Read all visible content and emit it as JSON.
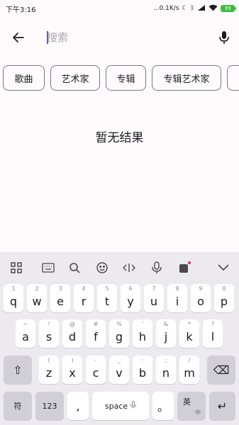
{
  "status": {
    "time": "下午3:16",
    "right_text": "...0.1K/s",
    "battery": "39"
  },
  "search": {
    "placeholder": "搜索"
  },
  "chips": [
    "歌曲",
    "艺术家",
    "专辑",
    "专辑艺术家"
  ],
  "empty_text": "暂无结果",
  "keyboard": {
    "row1": [
      {
        "main": "q",
        "hint": "1"
      },
      {
        "main": "w",
        "hint": "2"
      },
      {
        "main": "e",
        "hint": "3"
      },
      {
        "main": "r",
        "hint": "4"
      },
      {
        "main": "t",
        "hint": "5"
      },
      {
        "main": "y",
        "hint": "6"
      },
      {
        "main": "u",
        "hint": "7"
      },
      {
        "main": "i",
        "hint": "8"
      },
      {
        "main": "o",
        "hint": "9"
      },
      {
        "main": "p",
        "hint": "0"
      }
    ],
    "row2": [
      {
        "main": "a",
        "hint": "~"
      },
      {
        "main": "s",
        "hint": "!"
      },
      {
        "main": "d",
        "hint": "@"
      },
      {
        "main": "f",
        "hint": "#"
      },
      {
        "main": "g",
        "hint": "%"
      },
      {
        "main": "h",
        "hint": "'"
      },
      {
        "main": "j",
        "hint": "&"
      },
      {
        "main": "k",
        "hint": "*"
      },
      {
        "main": "l",
        "hint": "?"
      }
    ],
    "row3": [
      {
        "main": "z",
        "hint": "("
      },
      {
        "main": "x",
        "hint": ")"
      },
      {
        "main": "c",
        "hint": "-"
      },
      {
        "main": "v",
        "hint": "_"
      },
      {
        "main": "b",
        "hint": ":"
      },
      {
        "main": "n",
        "hint": ";"
      },
      {
        "main": "m",
        "hint": "/"
      }
    ],
    "shift": "⇧",
    "backspace": "⌫",
    "symbols": "符",
    "numbers": "123",
    "comma": ",",
    "space": "space",
    "period": "。",
    "lang_main": "英",
    "lang_sub": "中",
    "enter": "↵"
  }
}
